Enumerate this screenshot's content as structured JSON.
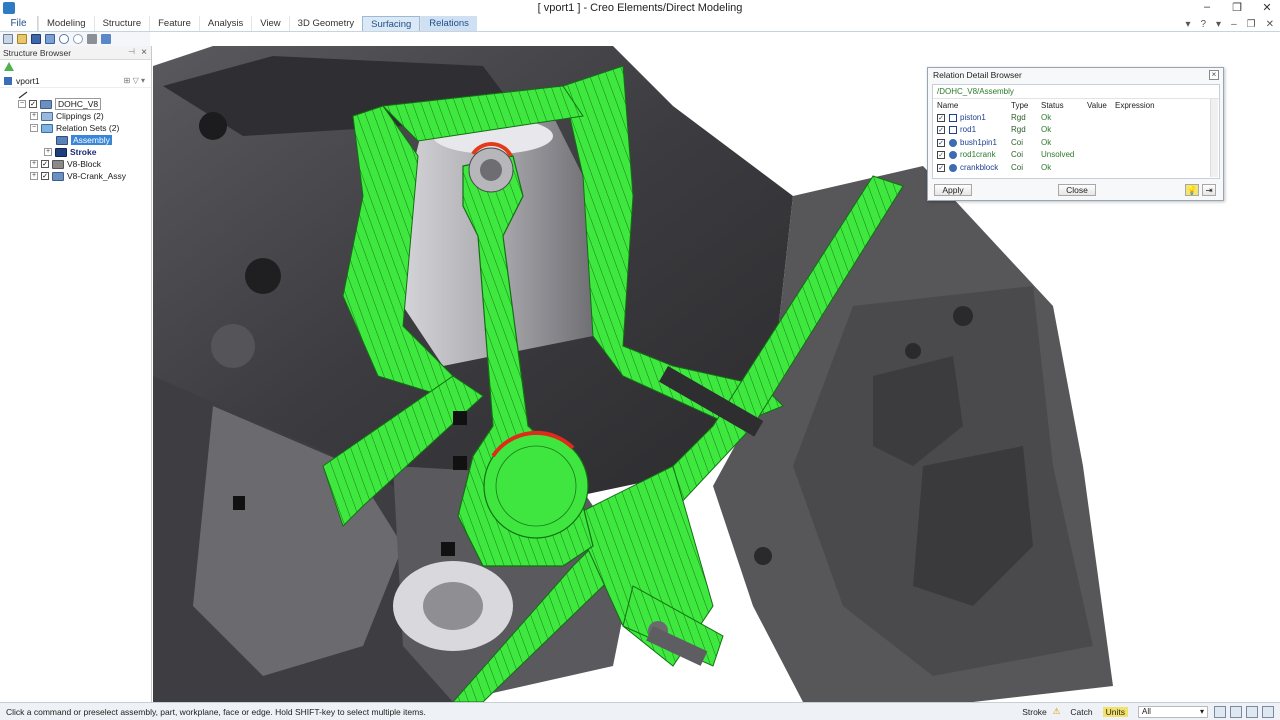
{
  "window": {
    "title": "[ vport1 ] - Creo Elements/Direct Modeling",
    "controls": [
      "–",
      "❐",
      "✕"
    ]
  },
  "menu": {
    "file": "File",
    "tabs": [
      "Modeling",
      "Structure",
      "Feature",
      "Analysis",
      "View",
      "3D Geometry",
      "Surfacing",
      "Relations"
    ],
    "active_tab": "Surfacing",
    "right_icons": [
      "▾",
      "?",
      "▾",
      "–",
      "❐",
      "✕"
    ]
  },
  "structure_browser": {
    "title": "Structure Browser",
    "viewport_label": "vport1",
    "tree": [
      {
        "label": "DOHC_V8",
        "icon": "assembly-icon",
        "checked": true,
        "level": 1,
        "expander": "−"
      },
      {
        "label": "Clippings (2)",
        "icon": "clipping-folder-icon",
        "level": 2,
        "expander": "+"
      },
      {
        "label": "Relation Sets (2)",
        "icon": "relation-set-icon",
        "level": 2,
        "expander": "−"
      },
      {
        "label": "Assembly",
        "icon": "relation-icon",
        "level": 3,
        "selected": true
      },
      {
        "label": "Stroke",
        "icon": "relation-icon",
        "level": 3,
        "bold": true,
        "expander": "+"
      },
      {
        "label": "V8-Block",
        "icon": "part-icon",
        "checked": true,
        "level": 2,
        "expander": "+"
      },
      {
        "label": "V8-Crank_Assy",
        "icon": "assembly-icon",
        "checked": true,
        "level": 2,
        "expander": "+"
      }
    ]
  },
  "relation_detail_browser": {
    "title": "Relation Detail Browser",
    "path": "/DOHC_V8/Assembly",
    "columns": [
      "Name",
      "Type",
      "Status",
      "Value",
      "Expression"
    ],
    "rows": [
      {
        "name": "piston1",
        "type": "Rgd",
        "status": "Ok",
        "icon": "rigid-icon"
      },
      {
        "name": "rod1",
        "type": "Rgd",
        "status": "Ok",
        "icon": "rigid-icon"
      },
      {
        "name": "bush1pin1",
        "type": "Coi",
        "status": "Ok",
        "icon": "coincident-icon"
      },
      {
        "name": "rod1crank",
        "type": "Coi",
        "status": "Unsolved",
        "icon": "coincident-icon"
      },
      {
        "name": "crankblock",
        "type": "Coi",
        "status": "Ok",
        "icon": "coincident-icon"
      }
    ],
    "apply_label": "Apply",
    "close_label": "Close"
  },
  "status_bar": {
    "message": "Click a command or preselect assembly, part, workplane, face or edge. Hold SHIFT-key to select multiple items.",
    "relation_set": "Stroke",
    "catch_label": "Catch",
    "units_label": "Units",
    "filter_value": "All"
  },
  "colors": {
    "section_green": "#39e63a",
    "metal_dark": "#4a4a4d",
    "metal_mid": "#7c7c80",
    "ribbon_active": "#dbe8f5",
    "selection_blue": "#3a86d6",
    "units_yellow": "#f2e26c"
  }
}
